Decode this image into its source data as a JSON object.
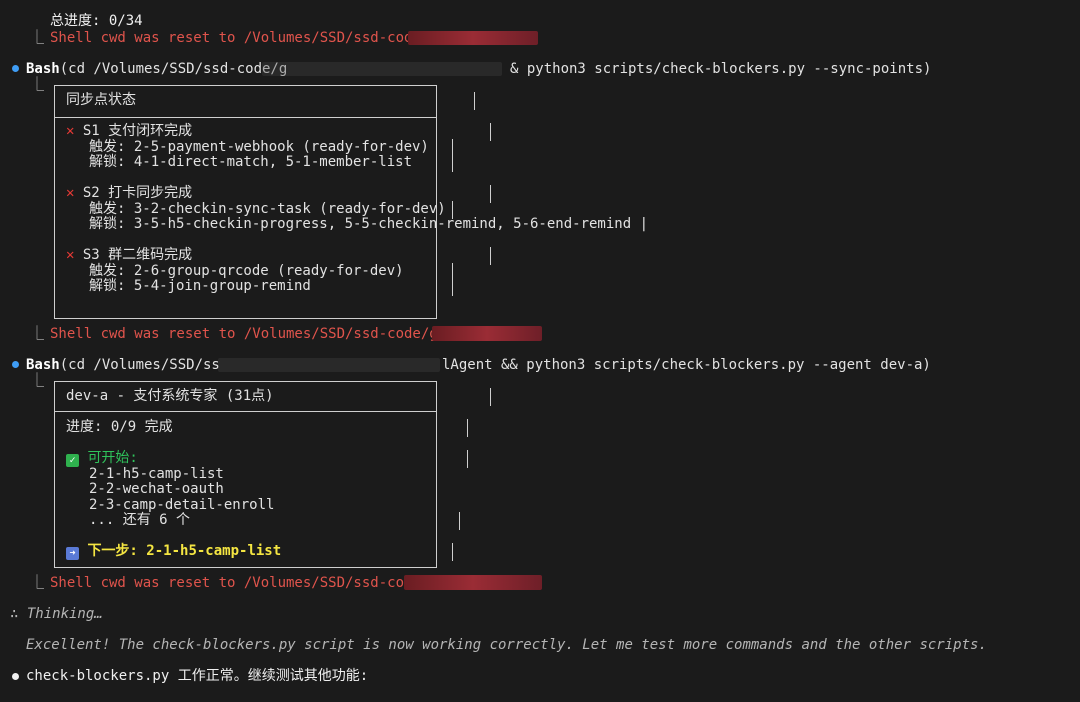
{
  "top": {
    "progress_line": "总进度: 0/34",
    "reset1": "Shell cwd was reset to /Volumes/SSD/ssd-code/"
  },
  "cmd1": {
    "tool": "Bash",
    "cmd_start": "(cd /Volumes/SSD/ssd-code/g",
    "cmd_end": "& python3 scripts/check-blockers.py --sync-points)"
  },
  "sync_box": {
    "title": "同步点状态",
    "points": [
      {
        "head": "S1 支付闭环完成",
        "trigger": "触发: 2-5-payment-webhook (ready-for-dev)",
        "unlock": "解锁: 4-1-direct-match, 5-1-member-list"
      },
      {
        "head": "S2 打卡同步完成",
        "trigger": "触发: 3-2-checkin-sync-task (ready-for-dev)",
        "unlock": "解锁: 3-5-h5-checkin-progress, 5-5-checkin-remind, 5-6-end-remind |"
      },
      {
        "head": "S3 群二维码完成",
        "trigger": "触发: 2-6-group-qrcode (ready-for-dev)",
        "unlock": "解锁: 5-4-join-group-remind"
      }
    ]
  },
  "reset2": "Shell cwd was reset to /Volumes/SSD/ssd-code/gi",
  "cmd2": {
    "tool": "Bash",
    "cmd_start": "(cd /Volumes/SSD/ss",
    "cmd_end": "lAgent && python3 scripts/check-blockers.py --agent dev-a)"
  },
  "agent_box": {
    "title": "dev-a - 支付系统专家 (31点)",
    "progress": "进度: 0/9 完成",
    "can_start_label": "可开始:",
    "items": [
      "2-1-h5-camp-list",
      "2-2-wechat-oauth",
      "2-3-camp-detail-enroll",
      "... 还有 6 个"
    ],
    "next_step": "下一步: 2-1-h5-camp-list"
  },
  "reset3": "Shell cwd was reset to /Volumes/SSD/ssd-code/g",
  "thinking": {
    "label": "∴ Thinking…",
    "text": "Excellent! The check-blockers.py script is now working correctly. Let me test more commands and the other scripts."
  },
  "reply": "check-blockers.py 工作正常。继续测试其他功能:",
  "colors": {
    "background": "#1b1b1b",
    "error": "#e0544c",
    "ok": "#2fc25b",
    "highlight": "#f5e642",
    "tool_dot": "#3f9df5"
  }
}
